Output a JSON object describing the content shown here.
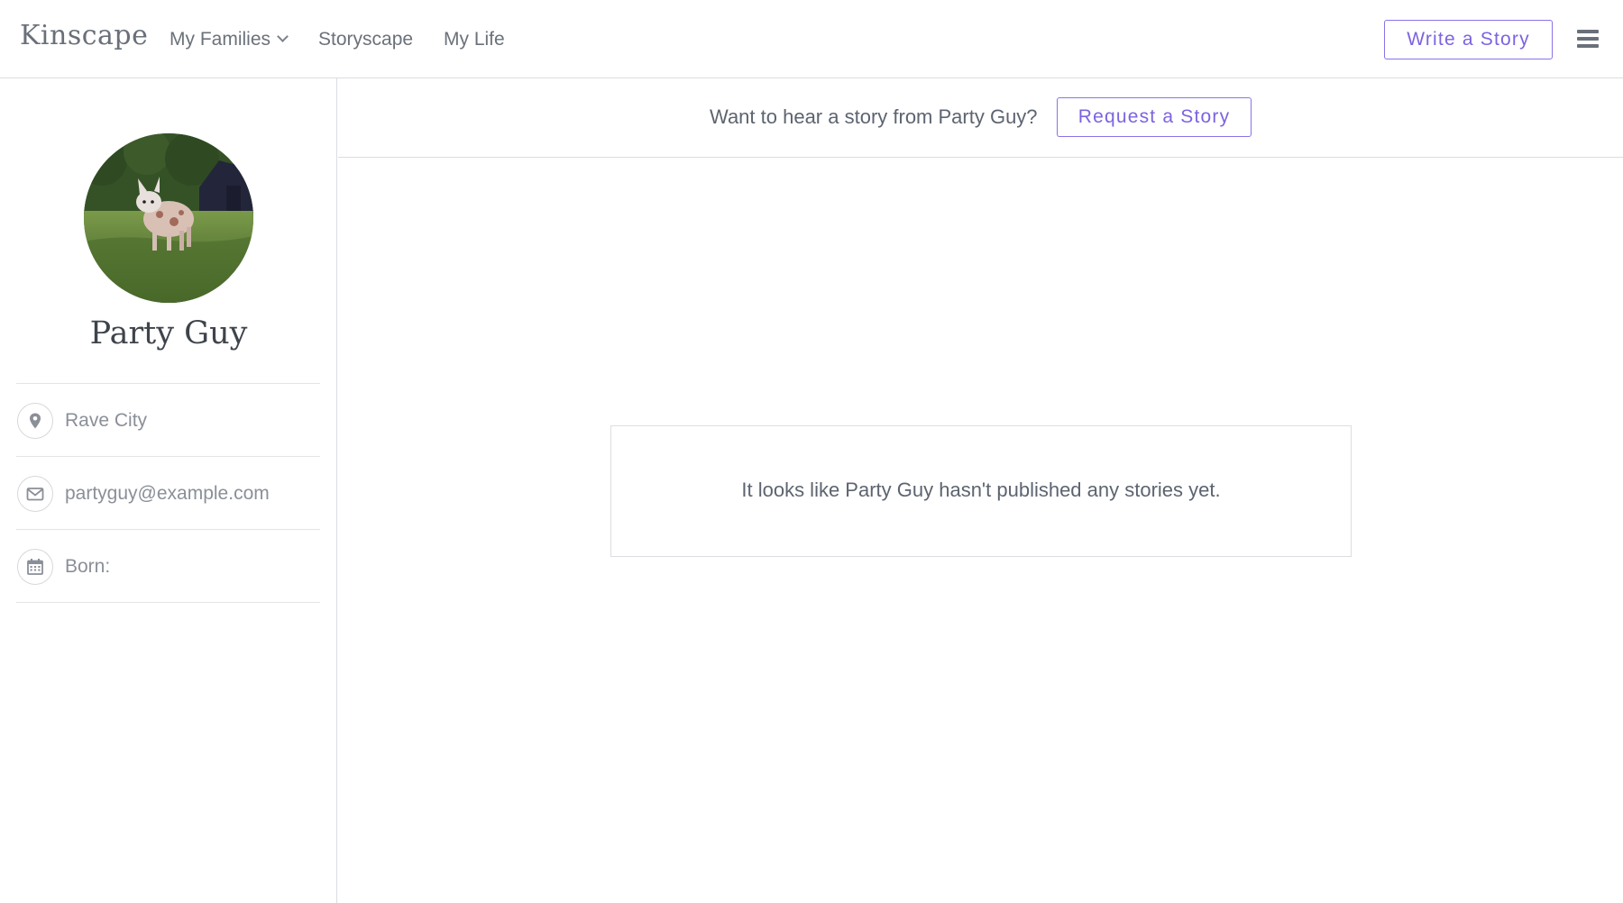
{
  "header": {
    "logo_text": "Kinscape",
    "nav": [
      {
        "label": "My Families",
        "has_dropdown": true
      },
      {
        "label": "Storyscape"
      },
      {
        "label": "My Life"
      }
    ],
    "write_button_label": "Write a Story",
    "menu_icon": "hamburger-menu-icon"
  },
  "sidebar": {
    "avatar_icon": "profile-photo",
    "name": "Party Guy",
    "info": [
      {
        "icon": "location-pin-icon",
        "text": "Rave City"
      },
      {
        "icon": "envelope-icon",
        "text": "partyguy@example.com"
      },
      {
        "icon": "calendar-icon",
        "text": "Born:"
      }
    ]
  },
  "main": {
    "request_prompt": "Want to hear a story from Party Guy?",
    "request_button_label": "Request a Story",
    "empty_message": "It looks like Party Guy hasn't published any stories yet."
  },
  "colors": {
    "accent": "#7d63e0",
    "text": "#5d6470",
    "muted": "#8a8f98",
    "border": "#dcdde1"
  }
}
